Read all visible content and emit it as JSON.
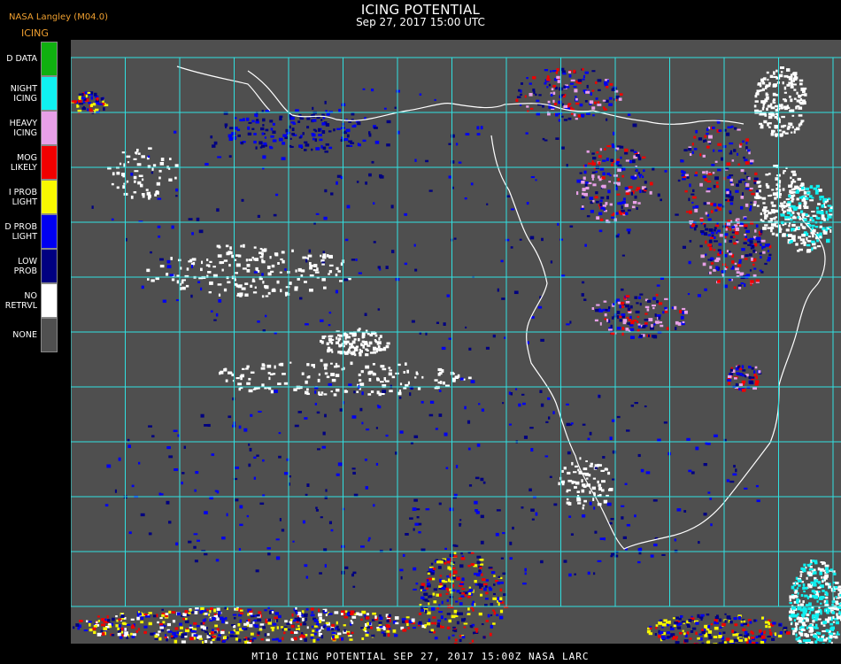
{
  "header": {
    "source": "NASA Langley (M04.0)",
    "product": "ICING",
    "title": "ICING POTENTIAL",
    "subtitle": "Sep 27, 2017 15:00 UTC"
  },
  "legend": [
    {
      "lines": [
        "D DATA"
      ],
      "color": "#10b010"
    },
    {
      "lines": [
        "NIGHT",
        "ICING"
      ],
      "color": "#10f0f0"
    },
    {
      "lines": [
        "HEAVY",
        "ICING"
      ],
      "color": "#e8a0e8"
    },
    {
      "lines": [
        "MOG",
        "LIKELY"
      ],
      "color": "#f00000"
    },
    {
      "lines": [
        "I PROB",
        "LIGHT"
      ],
      "color": "#f8f800"
    },
    {
      "lines": [
        "D PROB",
        "LIGHT"
      ],
      "color": "#0000f0"
    },
    {
      "lines": [
        "LOW",
        "PROB"
      ],
      "color": "#000080"
    },
    {
      "lines": [
        "NO",
        "RETRVL"
      ],
      "color": "#ffffff"
    },
    {
      "lines": [
        "NONE"
      ],
      "color": "#505050"
    }
  ],
  "colors": {
    "background": "#4f4f4f",
    "grid": "#30e0e0",
    "coast": "#ffffff",
    "label": "#d02020"
  },
  "footer": "MT10  ICING POTENTIAL   SEP 27, 2017 15:00Z   NASA LARC"
}
